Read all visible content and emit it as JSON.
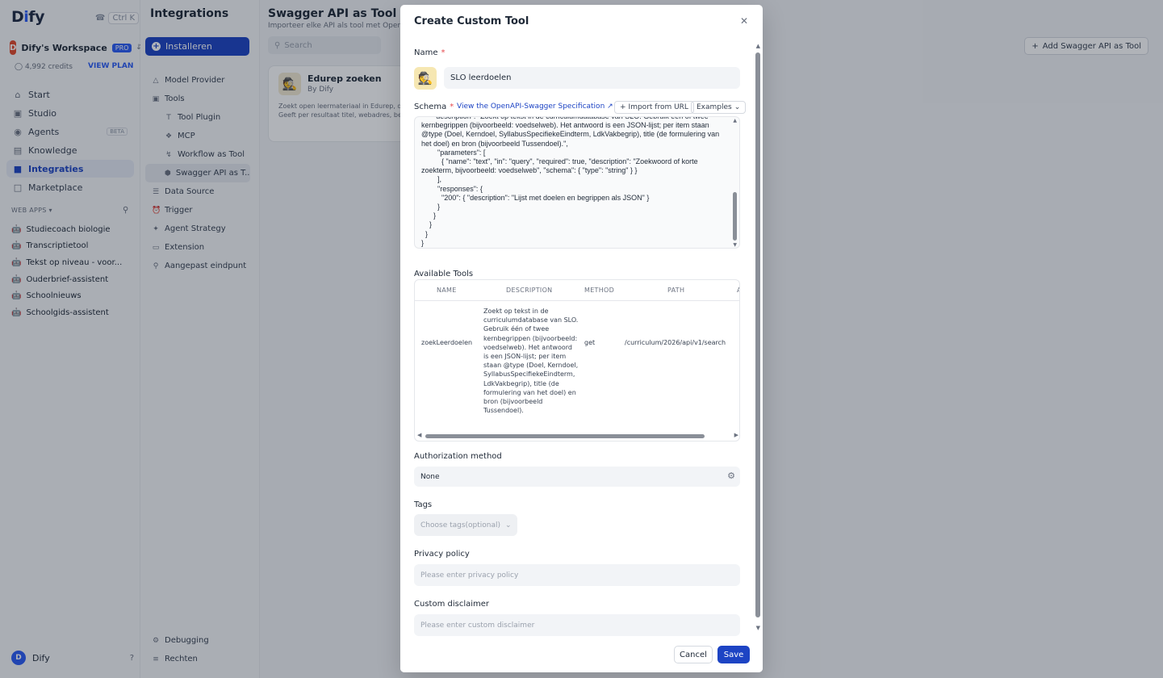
{
  "sidebar": {
    "logo_prefix": "D",
    "logo_accent": "i",
    "logo_suffix": "fy",
    "shortcut": "Ctrl K",
    "workspace": {
      "avatar": "D",
      "name": "Dify's Workspace",
      "badge": "PRO"
    },
    "credits": "4,992 credits",
    "view_plan": "VIEW PLAN",
    "nav": [
      {
        "label": "Start",
        "icon": "home-icon"
      },
      {
        "label": "Studio",
        "icon": "studio-icon"
      },
      {
        "label": "Agents",
        "icon": "agent-icon",
        "badge": "BETA"
      },
      {
        "label": "Knowledge",
        "icon": "book-icon"
      },
      {
        "label": "Integraties",
        "icon": "integrations-icon",
        "active": true
      },
      {
        "label": "Marketplace",
        "icon": "store-icon"
      }
    ],
    "webapps_label": "WEB APPS",
    "apps": [
      "Studiecoach biologie",
      "Transcriptietool",
      "Tekst op niveau - voor...",
      "Ouderbrief-assistent",
      "Schoolnieuws",
      "Schoolgids-assistent"
    ],
    "user": {
      "avatar": "D",
      "name": "Dify",
      "help": "?"
    }
  },
  "subnav": {
    "title": "Integrations",
    "install": "Installeren",
    "items": [
      {
        "label": "Model Provider",
        "child": false
      },
      {
        "label": "Tools",
        "child": false
      },
      {
        "label": "Tool Plugin",
        "child": true
      },
      {
        "label": "MCP",
        "child": true
      },
      {
        "label": "Workflow as Tool",
        "child": true
      },
      {
        "label": "Swagger API as T...",
        "child": true,
        "active": true
      },
      {
        "label": "Data Source",
        "child": false
      },
      {
        "label": "Trigger",
        "child": false
      },
      {
        "label": "Agent Strategy",
        "child": false
      },
      {
        "label": "Extension",
        "child": false
      },
      {
        "label": "Aangepast eindpunt",
        "child": false
      }
    ],
    "bottom": [
      "Debugging",
      "Rechten"
    ]
  },
  "main": {
    "title": "Swagger API as Tool",
    "subtitle": "Importeer elke API als tool met OpenAPI/",
    "search_placeholder": "Search",
    "add_button": "Add Swagger API as Tool",
    "card": {
      "name": "Edurep zoeken",
      "author": "By Dify",
      "desc_line1": "Zoekt open leermateriaal in Edurep, de",
      "desc_line2": "Geeft per resultaat titel, webadres, be"
    }
  },
  "modal": {
    "title": "Create Custom Tool",
    "name_label": "Name",
    "name_value": "SLO leerdoelen",
    "schema_label": "Schema",
    "spec_link": "View the OpenAPI-Swagger Specification",
    "import_url": "Import from URL",
    "examples": "Examples",
    "schema_text": "      \"description\": \"Zoekt op tekst in de curriculumdatabase van SLO. Gebruik één of twee kernbegrippen (bijvoorbeeld: voedselweb). Het antwoord is een JSON-lijst; per item staan @type (Doel, Kerndoel, SyllabusSpecifiekeEindterm, LdkVakbegrip), title (de formulering van het doel) en bron (bijvoorbeeld Tussendoel).\",\n        \"parameters\": [\n          { \"name\": \"text\", \"in\": \"query\", \"required\": true, \"description\": \"Zoekwoord of korte zoekterm, bijvoorbeeld: voedselweb\", \"schema\": { \"type\": \"string\" } }\n        ],\n        \"responses\": {\n          \"200\": { \"description\": \"Lijst met doelen en begrippen als JSON\" }\n        }\n      }\n    }\n  }\n}",
    "available_tools_label": "Available Tools",
    "table": {
      "headers": [
        "NAME",
        "DESCRIPTION",
        "METHOD",
        "PATH",
        "A"
      ],
      "rows": [
        {
          "name": "zoekLeerdoelen",
          "description": "Zoekt op tekst in de curriculumdatabase van SLO. Gebruik één of twee kernbegrippen (bijvoorbeeld: voedselweb). Het antwoord is een JSON-lijst; per item staan @type (Doel, Kerndoel, SyllabusSpecifiekeEindterm, LdkVakbegrip), title (de formulering van het doel) en bron (bijvoorbeeld Tussendoel).",
          "method": "get",
          "path": "/curriculum/2026/api/v1/search"
        }
      ]
    },
    "auth_label": "Authorization method",
    "auth_value": "None",
    "tags_label": "Tags",
    "tags_placeholder": "Choose tags(optional)",
    "privacy_label": "Privacy policy",
    "privacy_placeholder": "Please enter privacy policy",
    "disclaimer_label": "Custom disclaimer",
    "disclaimer_placeholder": "Please enter custom disclaimer",
    "cancel": "Cancel",
    "save": "Save"
  },
  "colors": {
    "accent": "#1d44c4",
    "required": "#e5484d",
    "overlay": "rgba(16,24,40,0.33)"
  }
}
